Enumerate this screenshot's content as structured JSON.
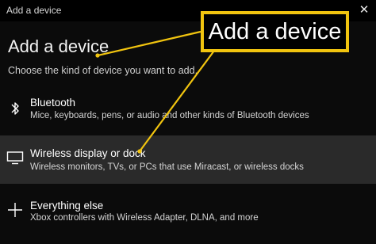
{
  "window": {
    "title": "Add a device"
  },
  "page": {
    "heading": "Add a device",
    "subtitle": "Choose the kind of device you want to add."
  },
  "options": [
    {
      "title": "Bluetooth",
      "description": "Mice, keyboards, pens, or audio and other kinds of Bluetooth devices",
      "icon": "bluetooth-icon"
    },
    {
      "title": "Wireless display or dock",
      "description": "Wireless monitors, TVs, or PCs that use Miracast, or wireless docks",
      "icon": "monitor-icon"
    },
    {
      "title": "Everything else",
      "description": "Xbox controllers with Wireless Adapter, DLNA, and more",
      "icon": "plus-icon"
    }
  ],
  "callout": {
    "text": "Add a device",
    "color": "#f1c40f"
  }
}
